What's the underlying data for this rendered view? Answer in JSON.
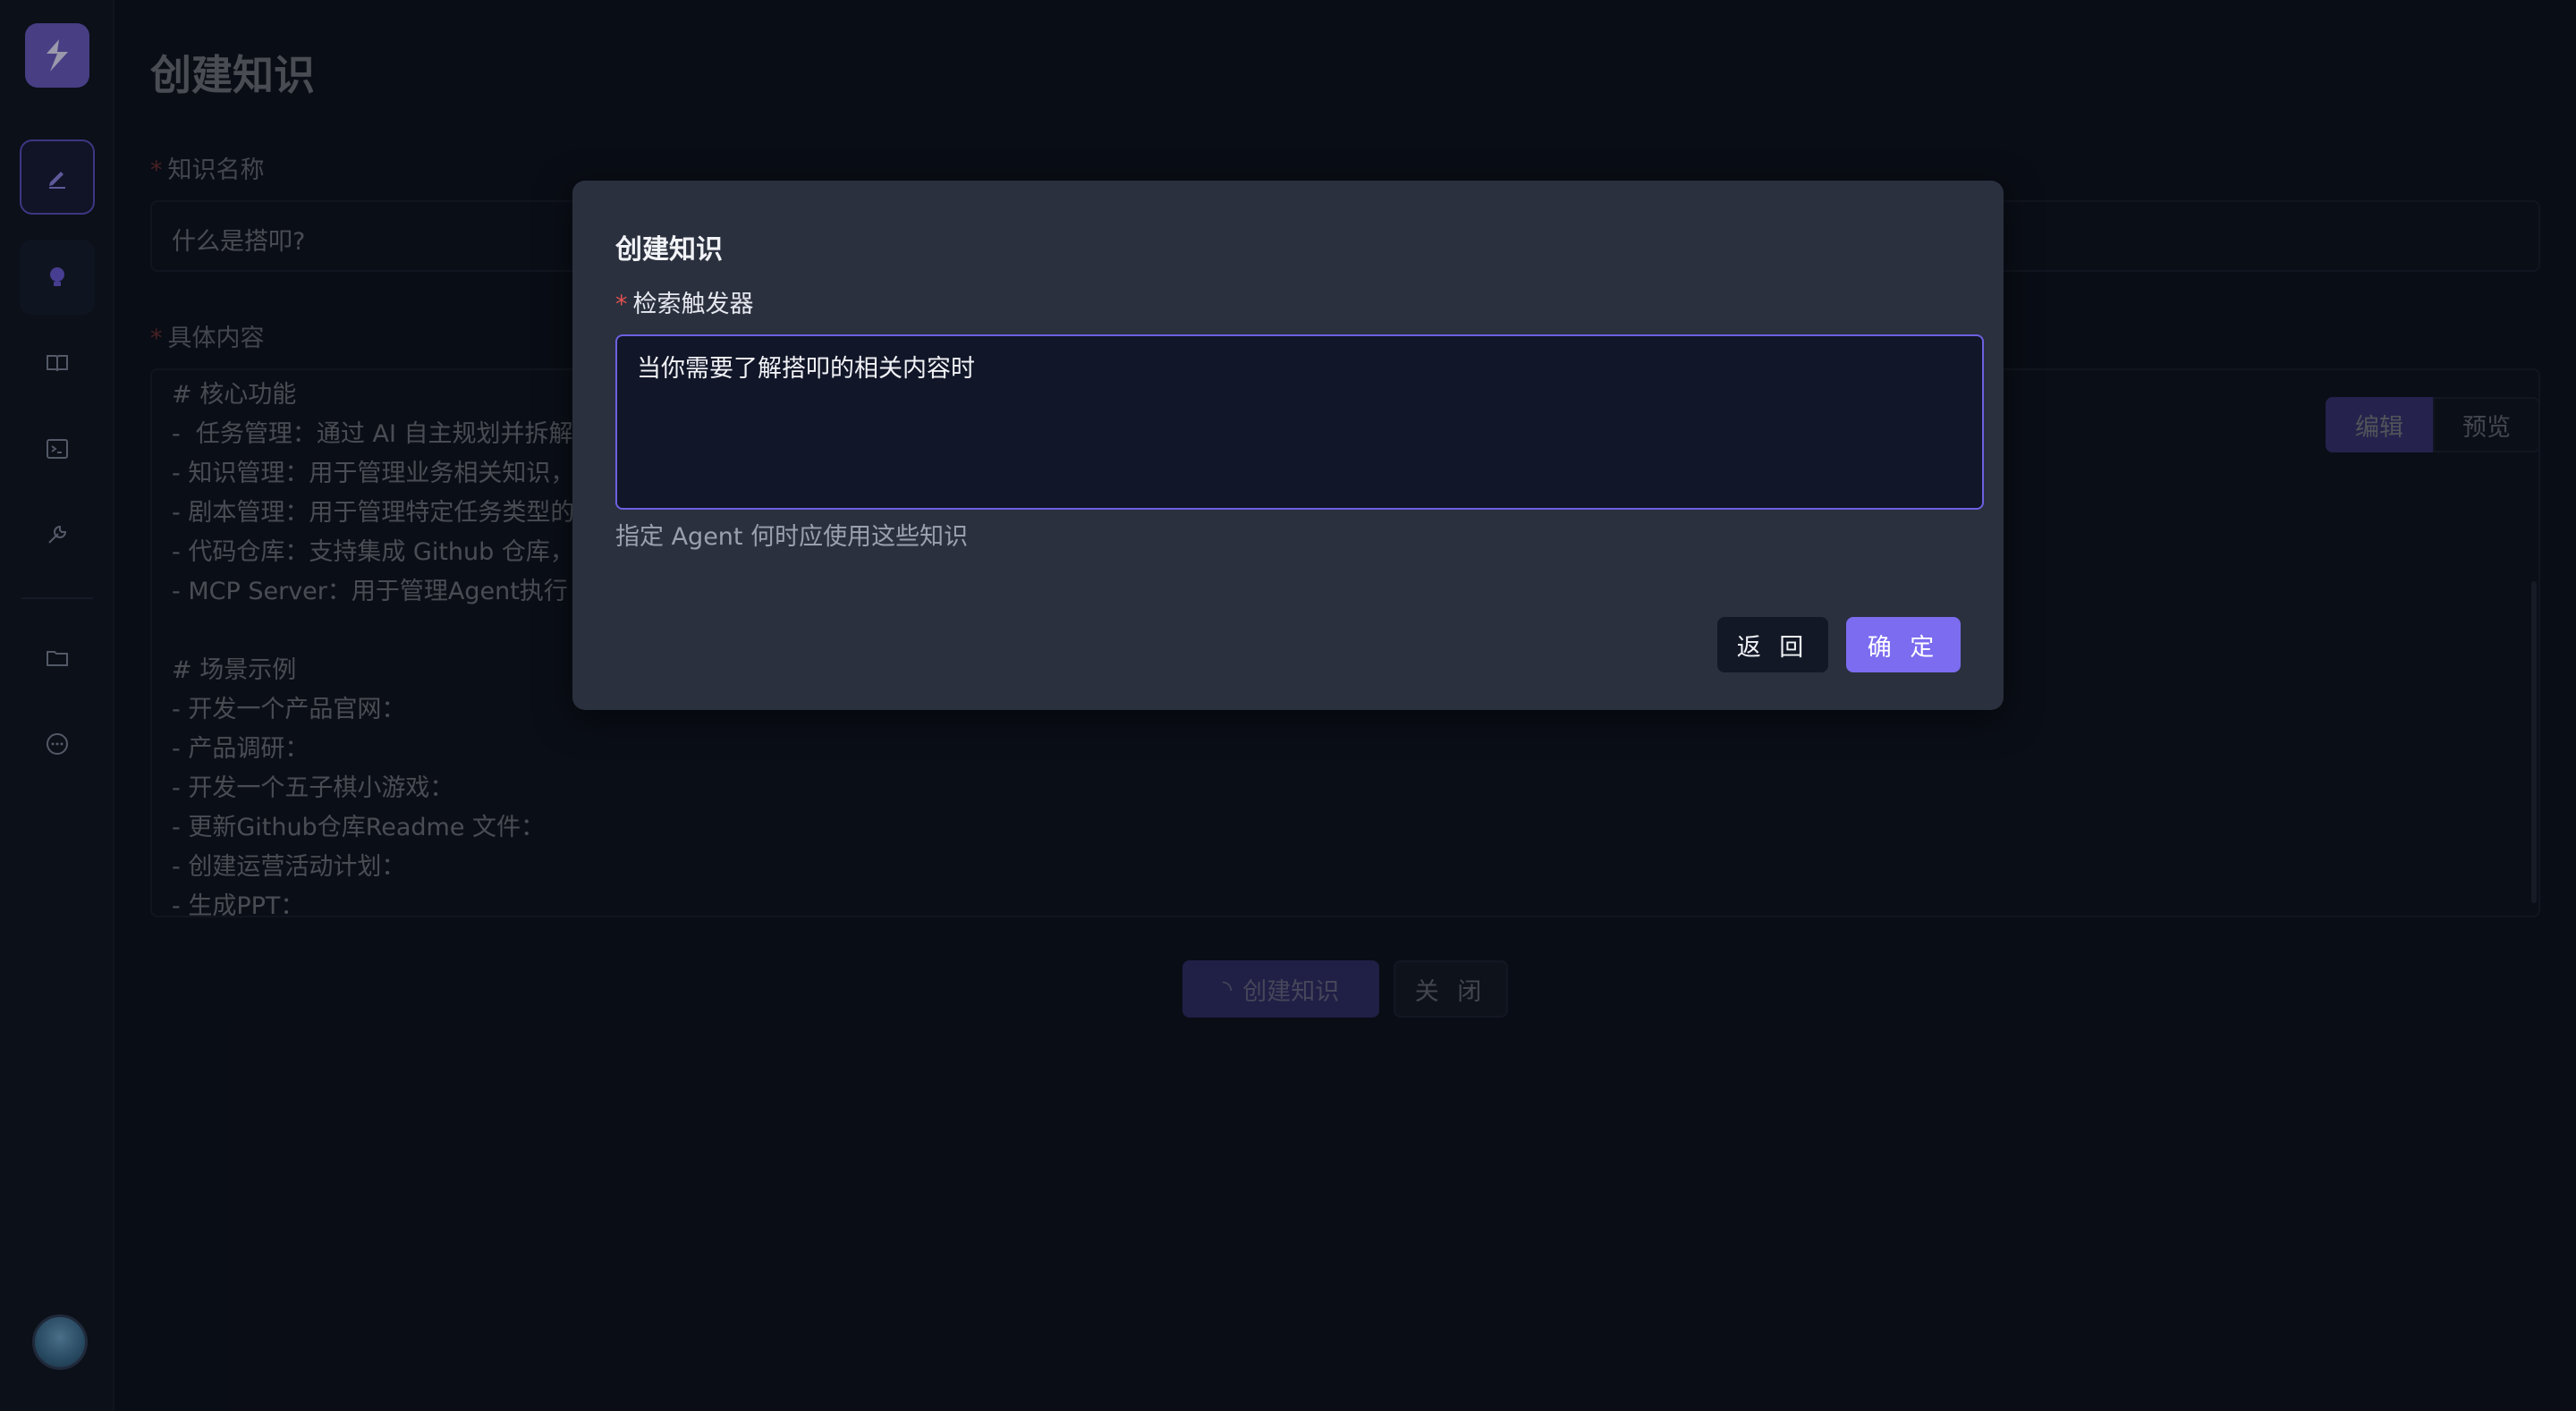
{
  "page": {
    "title": "创建知识",
    "name_label": "知识名称",
    "name_value": "什么是搭叩?",
    "content_label": "具体内容",
    "content_lines": [
      "# 核心功能",
      "-  任务管理：通过 AI 自主规划并拆解",
      "- 知识管理：用于管理业务相关知识，",
      "- 剧本管理：用于管理特定任务类型的",
      "- 代码仓库：支持集成 Github 仓库，",
      "- MCP Server：用于管理Agent执行",
      "",
      "# 场景示例",
      "- 开发一个产品官网：",
      "- 产品调研：",
      "- 开发一个五子棋小游戏：",
      "- 更新Github仓库Readme 文件：",
      "- 创建运营活动计划：",
      "- 生成PPT："
    ],
    "tab_edit": "编辑",
    "tab_preview": "预览",
    "create_button": "创建知识",
    "close_button": "关 闭"
  },
  "modal": {
    "title": "创建知识",
    "field_label": "检索触发器",
    "field_value": "当你需要了解搭叩的相关内容时",
    "hint": "指定 Agent 何时应使用这些知识",
    "back_button": "返 回",
    "ok_button": "确 定"
  },
  "sidebar": {
    "icons": [
      "edit-icon",
      "bulb-icon",
      "book-icon",
      "terminal-icon",
      "wrench-icon",
      "folder-icon",
      "chat-icon"
    ]
  },
  "colors": {
    "accent": "#7c6cf0",
    "background": "#0c1019",
    "modal": "#2a303e",
    "required": "#e05252"
  }
}
